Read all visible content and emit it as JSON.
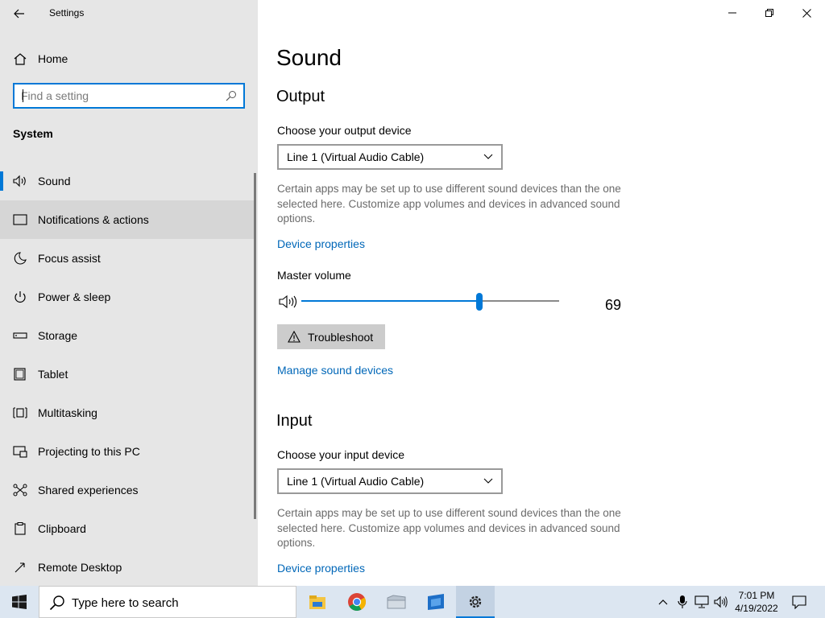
{
  "window": {
    "title": "Settings",
    "controls": [
      "minimize",
      "restore",
      "close"
    ]
  },
  "sidebar": {
    "home_label": "Home",
    "search_placeholder": "Find a setting",
    "section_title": "System",
    "items": [
      {
        "label": "Sound",
        "icon": "speaker-icon",
        "selected": true
      },
      {
        "label": "Notifications & actions",
        "icon": "notifications-icon",
        "hover": true
      },
      {
        "label": "Focus assist",
        "icon": "moon-icon"
      },
      {
        "label": "Power & sleep",
        "icon": "power-icon"
      },
      {
        "label": "Storage",
        "icon": "storage-icon"
      },
      {
        "label": "Tablet",
        "icon": "tablet-icon"
      },
      {
        "label": "Multitasking",
        "icon": "multitasking-icon"
      },
      {
        "label": "Projecting to this PC",
        "icon": "projecting-icon"
      },
      {
        "label": "Shared experiences",
        "icon": "shared-experiences-icon"
      },
      {
        "label": "Clipboard",
        "icon": "clipboard-icon"
      },
      {
        "label": "Remote Desktop",
        "icon": "remote-desktop-icon"
      }
    ]
  },
  "main": {
    "title": "Sound",
    "output": {
      "heading": "Output",
      "device_label": "Choose your output device",
      "device_value": "Line 1 (Virtual Audio Cable)",
      "description": "Certain apps may be set up to use different sound devices than the one selected here. Customize app volumes and devices in advanced sound options.",
      "device_properties_link": "Device properties",
      "master_volume_label": "Master volume",
      "volume": 69,
      "troubleshoot_label": "Troubleshoot",
      "manage_link": "Manage sound devices"
    },
    "input": {
      "heading": "Input",
      "device_label": "Choose your input device",
      "device_value": "Line 1 (Virtual Audio Cable)",
      "description": "Certain apps may be set up to use different sound devices than the one selected here. Customize app volumes and devices in advanced sound options.",
      "device_properties_link": "Device properties"
    }
  },
  "taskbar": {
    "search_placeholder": "Type here to search",
    "apps": [
      "file-explorer-icon",
      "chrome-icon",
      "folder-icon",
      "store-icon",
      "settings-icon"
    ],
    "tray_icons": [
      "chevron-up-icon",
      "microphone-icon",
      "network-icon",
      "volume-icon"
    ],
    "time": "7:01 PM",
    "date": "4/19/2022"
  },
  "colors": {
    "accent": "#0078d7",
    "link": "#0067b8",
    "sidebar_bg": "#e6e6e6",
    "taskbar_bg": "#dce6f1"
  }
}
